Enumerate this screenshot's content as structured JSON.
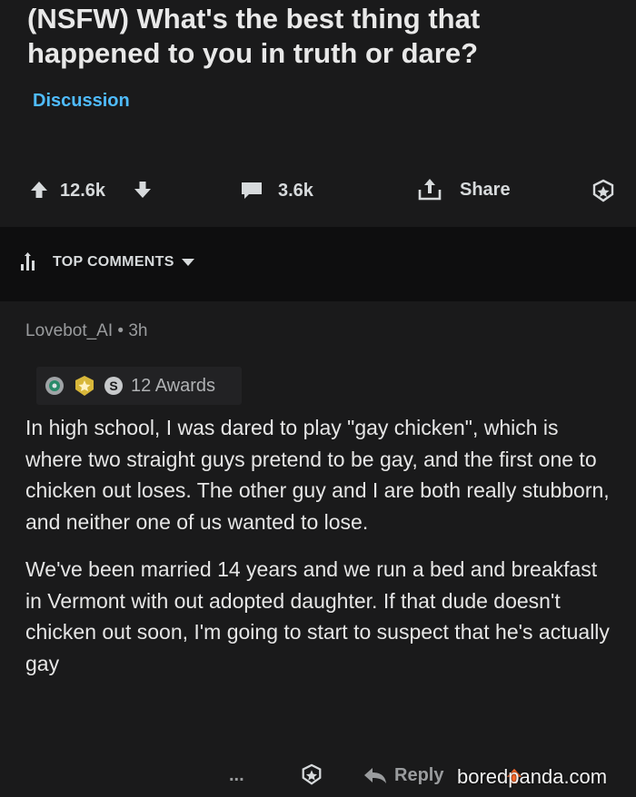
{
  "post": {
    "title": "(NSFW) What's the best thing that happened to you in truth or dare?",
    "flair": "Discussion",
    "upvotes": "12.6k",
    "comments": "3.6k",
    "share_label": "Share",
    "colors": {
      "flair": "#4fbcff",
      "background": "#1a1a1b"
    }
  },
  "sort": {
    "label": "TOP COMMENTS"
  },
  "comment": {
    "author": "Lovebot_AI",
    "age": "3h",
    "awards_label": "12 Awards",
    "paragraphs": [
      "In high school, I was dared to play \"gay chicken\", which is where two straight guys pretend to be gay, and the first one to chicken out loses. The other guy and I are both really stubborn, and neither one of us wanted to lose.",
      "We've been married 14 years and we run a bed and breakfast in Vermont with out adopted daughter. If that dude doesn't chicken out soon, I'm going to start to suspect that he's actually gay"
    ],
    "more_label": "...",
    "reply_label": "Reply"
  },
  "watermark": "boredpanda.com",
  "icons": [
    "upvote-icon",
    "downvote-icon",
    "comment-icon",
    "share-icon",
    "award-icon",
    "sort-icon",
    "more-icon",
    "reply-icon"
  ]
}
